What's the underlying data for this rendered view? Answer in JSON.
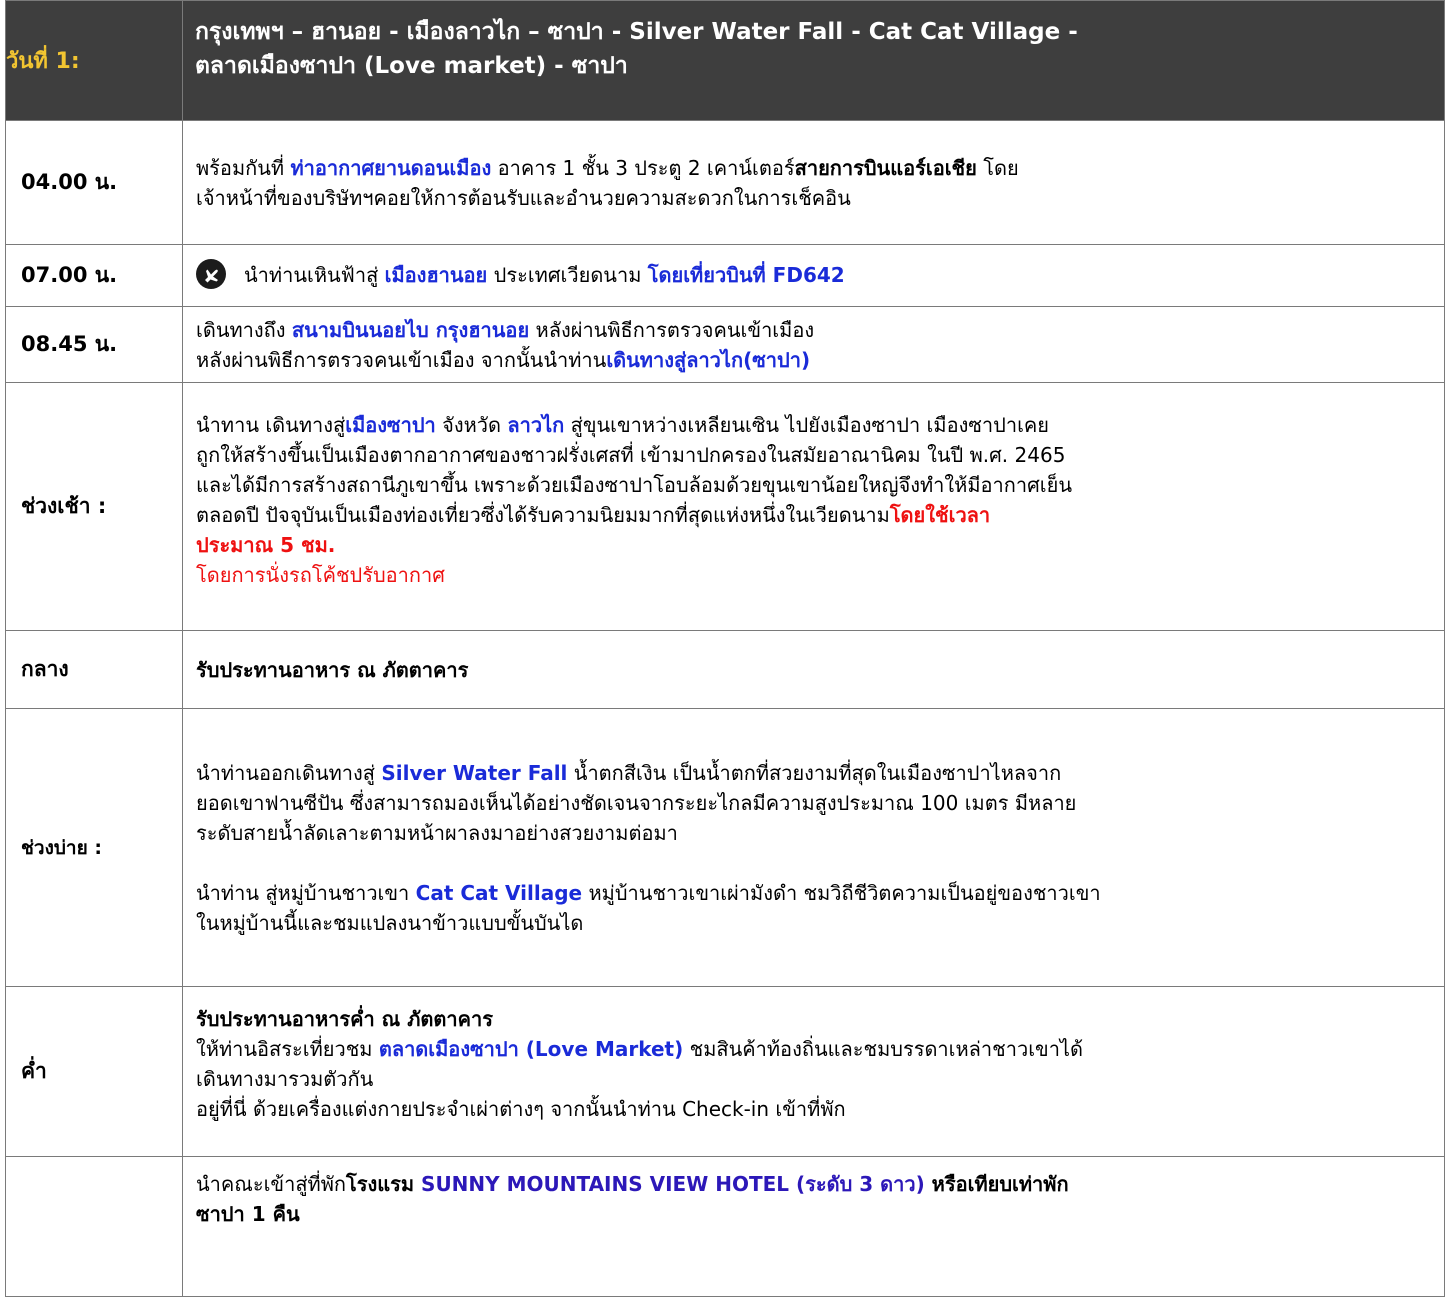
{
  "header": {
    "day_label": "วันที่ 1:",
    "title_line1": "กรุงเทพฯ – ฮานอย - เมืองลาวไก – ซาปา - Silver Water Fall - Cat Cat Village -",
    "title_line2": "ตลาดเมืองซาปา (Love market) - ซาปา"
  },
  "rows": {
    "r1": {
      "time": "04.00 น.",
      "s1": "พร้อมกันที่ ",
      "s2": "ท่าอากาศยานดอนเมือง",
      "s3": " อาคาร 1 ชั้น 3 ประตู 2 เคาน์เตอร์",
      "s4": "สายการบินแอร์เอเชีย",
      "s5": " โดย",
      "s6": "เจ้าหน้าที่ของบริษัทฯคอยให้การต้อนรับและอำนวยความสะดวกในการเช็คอิน"
    },
    "r2": {
      "time": "07.00 น.",
      "s1": "นำท่านเหินฟ้าสู่ ",
      "s2": "เมืองฮานอย",
      "s3": " ประเทศเวียดนาม ",
      "s4": "โดยเที่ยวบินที่ FD642"
    },
    "r3": {
      "time": "08.45 น.",
      "s1": "เดินทางถึง ",
      "s2": "สนามบินนอยไบ กรุงฮานอย",
      "s3": " หลังผ่านพิธีการตรวจคนเข้าเมือง",
      "s4": "หลังผ่านพิธีการตรวจคนเข้าเมือง จากนั้นนำท่าน",
      "s5": "เดินทางสู่ลาวไก(ซาปา)"
    },
    "r4": {
      "time": "ช่วงเช้า :",
      "s1": "นำทาน เดินทางสู่",
      "s2": "เมืองซาปา",
      "s3": " จังหวัด ",
      "s4": "ลาวไก",
      "s5": " สู่ขุนเขาหว่างเหลียนเซิน ไปยังเมืองซาปา เมืองซาปาเคย",
      "l2": "ถูกให้สร้างขึ้นเป็นเมืองตากอากาศของชาวฝรั่งเศสที่ เข้ามาปกครองในสมัยอาณานิคม ในปี พ.ศ. 2465",
      "l3": "และได้มีการสร้างสถานีภูเขาขึ้น เพราะด้วยเมืองซาปาโอบล้อมด้วยขุนเขาน้อยใหญ่จึงทำให้มีอากาศเย็น",
      "l4a": "ตลอดปี ปัจจุบันเป็นเมืองท่องเที่ยวซึ่งได้รับความนิยมมากที่สุดแห่งหนึ่งในเวียดนาม",
      "l4b": "โดยใช้เวลา",
      "l5": "ประมาณ 5 ชม.",
      "l6": "โดยการนั่งรถโค้ชปรับอากาศ"
    },
    "r5": {
      "time": "กลาง",
      "s1": "รับประทานอาหาร ณ ภัตตาคาร"
    },
    "r6": {
      "time": "ช่วงบ่าย :",
      "p1a": "นำท่านออกเดินทางสู่ ",
      "p1b": "Silver Water Fall",
      "p1c": " น้ำตกสีเงิน เป็นน้ำตกที่สวยงามที่สุดในเมืองซาปาไหลจาก",
      "p1l2": "ยอดเขาฟานซีปัน ซึ่งสามารถมองเห็นได้อย่างชัดเจนจากระยะไกลมีความสูงประมาณ 100 เมตร มีหลาย",
      "p1l3": "ระดับสายน้ำลัดเลาะตามหน้าผาลงมาอย่างสวยงามต่อมา",
      "p2a": "นำท่าน สู่หมู่บ้านชาวเขา ",
      "p2b": "Cat Cat Village",
      "p2c": " หมู่บ้านชาวเขาเผ่ามังดำ ชมวิถีชีวิตความเป็นอยู่ของชาวเขา",
      "p2l2": "ในหมู่บ้านนี้และชมแปลงนาข้าวแบบขั้นบันได"
    },
    "r7": {
      "time": "ค่ำ",
      "l1": "รับประทานอาหารค่ำ ณ ภัตตาคาร",
      "l2a": "ให้ท่านอิสระเที่ยวชม ",
      "l2b": "ตลาดเมืองซาปา (Love Market)",
      "l2c": " ชมสินค้าท้องถิ่นและชมบรรดาเหล่าชาวเขาได้",
      "l3": "เดินทางมารวมตัวกัน",
      "l4": "อยู่ที่นี่ ด้วยเครื่องแต่งกายประจำเผ่าต่างๆ จากนั้นนำท่าน Check-in เข้าที่พัก"
    },
    "r8": {
      "time": "",
      "s1": "นำคณะเข้าสู่ที่พัก",
      "s2": "โรงแรม",
      "s3": " SUNNY MOUNTAINS VIEW HOTEL (ระดับ 3 ดาว)",
      "s4": " หรือเทียบเท่าพัก",
      "l2": "ซาปา 1 คืน"
    }
  }
}
